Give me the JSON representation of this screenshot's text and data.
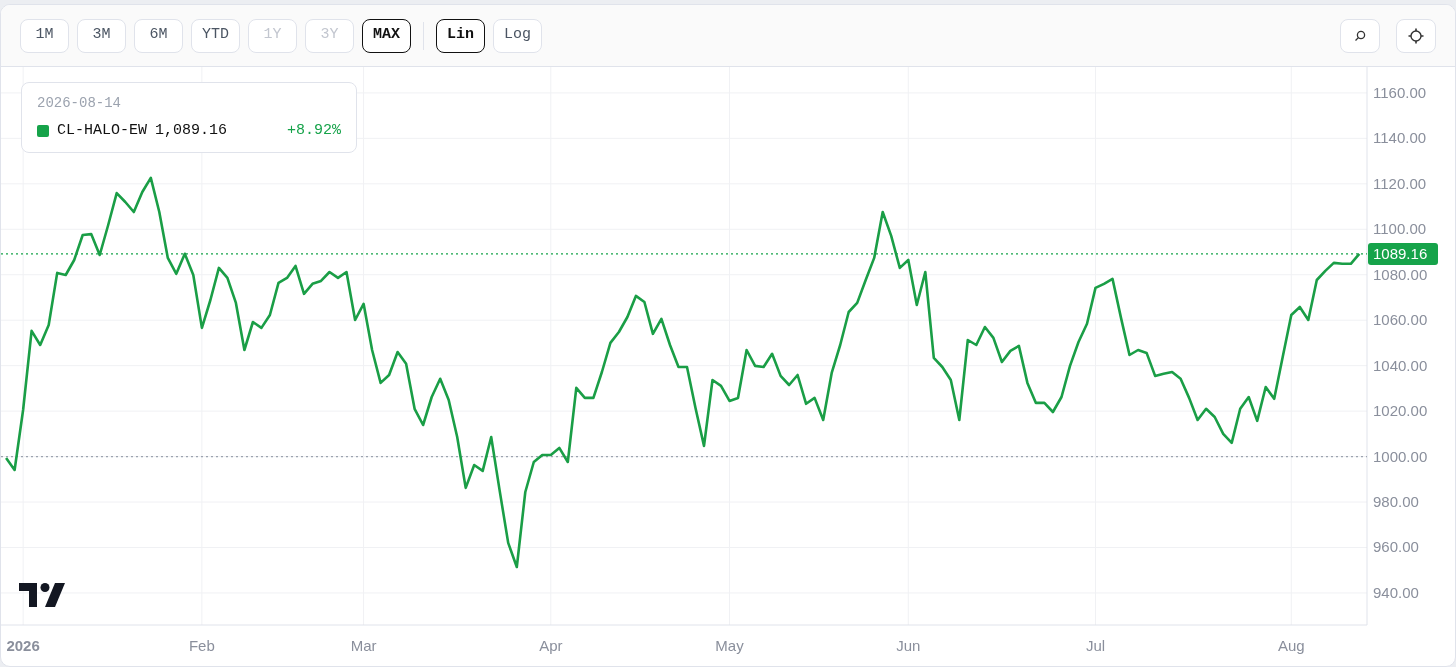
{
  "toolbar": {
    "ranges": [
      {
        "label": "1M",
        "selected": false,
        "disabled": false
      },
      {
        "label": "3M",
        "selected": false,
        "disabled": false
      },
      {
        "label": "6M",
        "selected": false,
        "disabled": false
      },
      {
        "label": "YTD",
        "selected": false,
        "disabled": false
      },
      {
        "label": "1Y",
        "selected": false,
        "disabled": true
      },
      {
        "label": "3Y",
        "selected": false,
        "disabled": true
      },
      {
        "label": "MAX",
        "selected": true,
        "disabled": false
      }
    ],
    "scales": [
      {
        "label": "Lin",
        "selected": true
      },
      {
        "label": "Log",
        "selected": false
      }
    ],
    "tools": [
      {
        "kind": "search"
      },
      {
        "kind": "settings"
      }
    ]
  },
  "legend": {
    "date": "2026-08-14",
    "items": [
      {
        "value": "1,089.16",
        "change": "+8.92%",
        "color": "#16a34a"
      }
    ]
  },
  "chart": {
    "chart_data": {
      "type": "line",
      "grid": true,
      "ylim": [
        925.9,
        1171.4
      ],
      "categories": [
        null,
        null,
        "2026",
        null,
        null,
        null,
        null,
        null,
        null,
        null,
        null,
        null,
        null,
        null,
        null,
        null,
        null,
        null,
        null,
        null,
        null,
        null,
        null,
        "Feb",
        null,
        null,
        null,
        null,
        null,
        null,
        null,
        null,
        null,
        null,
        null,
        null,
        null,
        null,
        null,
        null,
        null,
        null,
        "Mar",
        null,
        null,
        null,
        null,
        null,
        null,
        null,
        null,
        null,
        null,
        null,
        null,
        null,
        null,
        null,
        null,
        null,
        null,
        null,
        null,
        null,
        "Apr",
        null,
        null,
        null,
        null,
        null,
        null,
        null,
        null,
        null,
        null,
        null,
        null,
        null,
        null,
        null,
        null,
        null,
        null,
        null,
        null,
        "May",
        null,
        null,
        null,
        null,
        null,
        null,
        null,
        null,
        null,
        null,
        null,
        null,
        null,
        null,
        null,
        null,
        null,
        null,
        null,
        null,
        "Jun",
        null,
        null,
        null,
        null,
        null,
        null,
        null,
        null,
        null,
        null,
        null,
        null,
        null,
        null,
        null,
        null,
        null,
        null,
        null,
        null,
        null,
        "Jul",
        null,
        null,
        null,
        null,
        null,
        null,
        null,
        null,
        null,
        null,
        null,
        null,
        null,
        null,
        null,
        null,
        null,
        null,
        null,
        null,
        null,
        null,
        "Aug",
        null,
        null,
        null,
        null,
        null,
        null,
        null,
        null
      ],
      "yticks": [
        {
          "value": 940,
          "label": "940.00"
        },
        {
          "value": 960,
          "label": "960.00"
        },
        {
          "value": 980,
          "label": "980.00"
        },
        {
          "value": 1000,
          "label": "1000.00"
        },
        {
          "value": 1020,
          "label": "1020.00"
        },
        {
          "value": 1040,
          "label": "1040.00"
        },
        {
          "value": 1060,
          "label": "1060.00"
        },
        {
          "value": 1080,
          "label": "1080.00"
        },
        {
          "value": 1100,
          "label": "1100.00"
        },
        {
          "value": 1120,
          "label": "1120.00"
        },
        {
          "value": 1140,
          "label": "1140.00"
        },
        {
          "value": 1160,
          "label": "1160.00"
        }
      ],
      "series": [
        {
          "name": "CL-HALO-EW",
          "color": "#1a9e46",
          "values": [
            999.4,
            994.1,
            1020.5,
            1055.3,
            1049.1,
            1057.9,
            1080.8,
            1079.9,
            1086.5,
            1097.5,
            1097.9,
            1088.7,
            1101.9,
            1115.9,
            1112.0,
            1107.6,
            1116.4,
            1122.6,
            1107.6,
            1087.4,
            1080.4,
            1089.2,
            1079.9,
            1056.6,
            1068.9,
            1083.0,
            1078.6,
            1067.6,
            1046.9,
            1059.2,
            1056.6,
            1062.3,
            1076.4,
            1078.6,
            1083.9,
            1071.6,
            1076.0,
            1077.3,
            1081.2,
            1078.6,
            1081.2,
            1060.1,
            1067.2,
            1046.9,
            1032.4,
            1035.9,
            1046.0,
            1040.8,
            1021.0,
            1013.9,
            1026.2,
            1034.2,
            1024.9,
            1008.6,
            986.2,
            996.3,
            993.7,
            1008.6,
            984.9,
            962.0,
            951.4,
            984.4,
            997.6,
            1000.7,
            1000.7,
            1003.8,
            997.6,
            1030.2,
            1025.8,
            1025.8,
            1037.2,
            1050.0,
            1054.8,
            1061.4,
            1070.7,
            1068.0,
            1054.0,
            1060.6,
            1049.1,
            1039.4,
            1039.4,
            1021.4,
            1004.7,
            1033.7,
            1031.1,
            1024.5,
            1025.8,
            1046.9,
            1039.9,
            1039.4,
            1045.2,
            1035.5,
            1031.5,
            1035.9,
            1023.2,
            1025.8,
            1016.1,
            1036.8,
            1049.1,
            1063.6,
            1067.6,
            1077.7,
            1087.4,
            1107.6,
            1097.1,
            1083.0,
            1086.5,
            1066.7,
            1081.2,
            1043.4,
            1039.4,
            1033.7,
            1016.1,
            1051.3,
            1049.1,
            1057.0,
            1052.2,
            1041.6,
            1046.5,
            1048.7,
            1032.4,
            1023.6,
            1023.6,
            1019.6,
            1026.2,
            1039.9,
            1050.4,
            1058.4,
            1074.2,
            1076.0,
            1078.2,
            1061.0,
            1044.7,
            1046.9,
            1045.6,
            1035.5,
            1036.4,
            1037.2,
            1034.2,
            1025.8,
            1016.1,
            1021.0,
            1017.4,
            1010.0,
            1006.0,
            1021.0,
            1026.2,
            1015.7,
            1030.6,
            1025.4,
            1043.8,
            1062.3,
            1065.8,
            1060.1,
            1077.7,
            1081.7,
            1085.2,
            1084.8,
            1084.8,
            1089.2
          ]
        }
      ],
      "ref_lines": [
        {
          "axis": "y",
          "value": 1000,
          "color": "#9ca3af"
        },
        {
          "axis": "y",
          "value": 1089.16,
          "label": "1089.16",
          "color": "#16a34a"
        }
      ]
    }
  }
}
